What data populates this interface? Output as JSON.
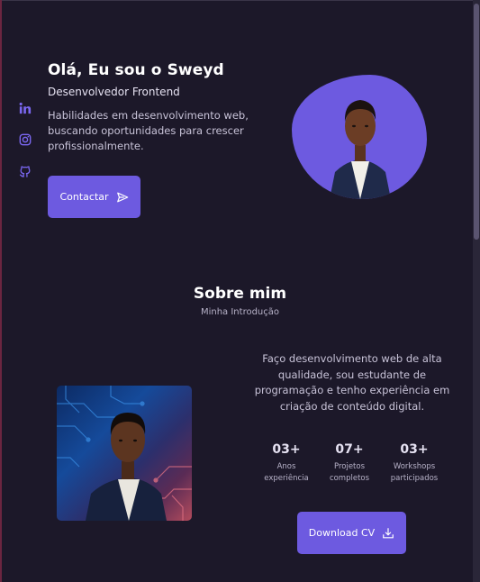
{
  "hero": {
    "title": "Olá, Eu sou o Sweyd",
    "subtitle": "Desenvolvedor Frontend",
    "description": "Habilidades em desenvolvimento web, buscando oportunidades para crescer profissionalmente.",
    "contact_label": "Contactar"
  },
  "social": [
    "linkedin-icon",
    "instagram-icon",
    "github-icon"
  ],
  "about": {
    "title": "Sobre mim",
    "subtitle": "Minha Introdução",
    "description": "Faço desenvolvimento web de alta qualidade, sou estudante de programação e tenho experiência em criação de conteúdo digital.",
    "stats": [
      {
        "value": "03+",
        "label_line1": "Anos",
        "label_line2": "experiência"
      },
      {
        "value": "07+",
        "label_line1": "Projetos",
        "label_line2": "completos"
      },
      {
        "value": "03+",
        "label_line1": "Workshops",
        "label_line2": "participados"
      }
    ],
    "download_label": "Download CV"
  },
  "colors": {
    "background": "#1c1829",
    "accent": "#6d5ae0",
    "text_primary": "#ffffff",
    "text_secondary": "#c8c3d8"
  }
}
